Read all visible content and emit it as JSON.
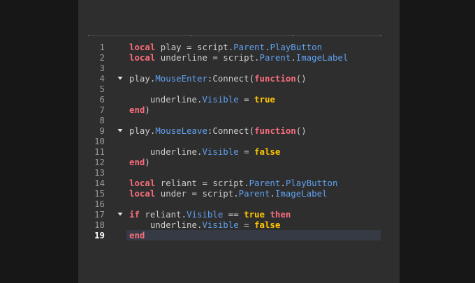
{
  "editor": {
    "current_line": 19,
    "lines": [
      {
        "n": "1",
        "fold": false,
        "tokens": [
          {
            "t": "local",
            "c": "kw"
          },
          {
            "t": " play = script.",
            "c": "id"
          },
          {
            "t": "Parent",
            "c": "prop"
          },
          {
            "t": ".",
            "c": "id"
          },
          {
            "t": "PlayButton",
            "c": "prop"
          }
        ]
      },
      {
        "n": "2",
        "fold": false,
        "tokens": [
          {
            "t": "local",
            "c": "kw"
          },
          {
            "t": " underline = script.",
            "c": "id"
          },
          {
            "t": "Parent",
            "c": "prop"
          },
          {
            "t": ".",
            "c": "id"
          },
          {
            "t": "ImageLabel",
            "c": "prop"
          }
        ]
      },
      {
        "n": "3",
        "fold": false,
        "tokens": []
      },
      {
        "n": "4",
        "fold": true,
        "tokens": [
          {
            "t": "play.",
            "c": "id"
          },
          {
            "t": "MouseEnter",
            "c": "prop"
          },
          {
            "t": ":Connect(",
            "c": "id"
          },
          {
            "t": "function",
            "c": "kw"
          },
          {
            "t": "()",
            "c": "id"
          }
        ]
      },
      {
        "n": "5",
        "fold": false,
        "tokens": []
      },
      {
        "n": "6",
        "fold": false,
        "tokens": [
          {
            "t": "    underline.",
            "c": "id"
          },
          {
            "t": "Visible",
            "c": "prop"
          },
          {
            "t": " = ",
            "c": "op"
          },
          {
            "t": "true",
            "c": "bool"
          }
        ]
      },
      {
        "n": "7",
        "fold": false,
        "tokens": [
          {
            "t": "end",
            "c": "kw"
          },
          {
            "t": ")",
            "c": "id"
          }
        ]
      },
      {
        "n": "8",
        "fold": false,
        "tokens": []
      },
      {
        "n": "9",
        "fold": true,
        "tokens": [
          {
            "t": "play.",
            "c": "id"
          },
          {
            "t": "MouseLeave",
            "c": "prop"
          },
          {
            "t": ":Connect(",
            "c": "id"
          },
          {
            "t": "function",
            "c": "kw"
          },
          {
            "t": "()",
            "c": "id"
          }
        ]
      },
      {
        "n": "10",
        "fold": false,
        "tokens": []
      },
      {
        "n": "11",
        "fold": false,
        "tokens": [
          {
            "t": "    underline.",
            "c": "id"
          },
          {
            "t": "Visible",
            "c": "prop"
          },
          {
            "t": " = ",
            "c": "op"
          },
          {
            "t": "false",
            "c": "bool"
          }
        ]
      },
      {
        "n": "12",
        "fold": false,
        "tokens": [
          {
            "t": "end",
            "c": "kw"
          },
          {
            "t": ")",
            "c": "id"
          }
        ]
      },
      {
        "n": "13",
        "fold": false,
        "tokens": []
      },
      {
        "n": "14",
        "fold": false,
        "tokens": [
          {
            "t": "local",
            "c": "kw"
          },
          {
            "t": " reliant = script.",
            "c": "id"
          },
          {
            "t": "Parent",
            "c": "prop"
          },
          {
            "t": ".",
            "c": "id"
          },
          {
            "t": "PlayButton",
            "c": "prop"
          }
        ]
      },
      {
        "n": "15",
        "fold": false,
        "tokens": [
          {
            "t": "local",
            "c": "kw"
          },
          {
            "t": " under = script.",
            "c": "id"
          },
          {
            "t": "Parent",
            "c": "prop"
          },
          {
            "t": ".",
            "c": "id"
          },
          {
            "t": "ImageLabel",
            "c": "prop"
          }
        ]
      },
      {
        "n": "16",
        "fold": false,
        "tokens": []
      },
      {
        "n": "17",
        "fold": true,
        "tokens": [
          {
            "t": "if",
            "c": "kw"
          },
          {
            "t": " reliant.",
            "c": "id"
          },
          {
            "t": "Visible",
            "c": "prop"
          },
          {
            "t": " == ",
            "c": "op"
          },
          {
            "t": "true",
            "c": "bool"
          },
          {
            "t": " ",
            "c": "id"
          },
          {
            "t": "then",
            "c": "kw"
          }
        ]
      },
      {
        "n": "18",
        "fold": false,
        "tokens": [
          {
            "t": "    underline.",
            "c": "id"
          },
          {
            "t": "Visible",
            "c": "prop"
          },
          {
            "t": " = ",
            "c": "op"
          },
          {
            "t": "false",
            "c": "bool"
          }
        ]
      },
      {
        "n": "19",
        "fold": false,
        "tokens": [
          {
            "t": "end",
            "c": "kw"
          }
        ]
      }
    ],
    "fold_icon": "triangle-down-icon",
    "colors": {
      "keyword": "#f86d7c",
      "property": "#61a1f1",
      "boolean": "#ffc600",
      "text": "#cccccc",
      "background": "#2e2e2e"
    }
  }
}
